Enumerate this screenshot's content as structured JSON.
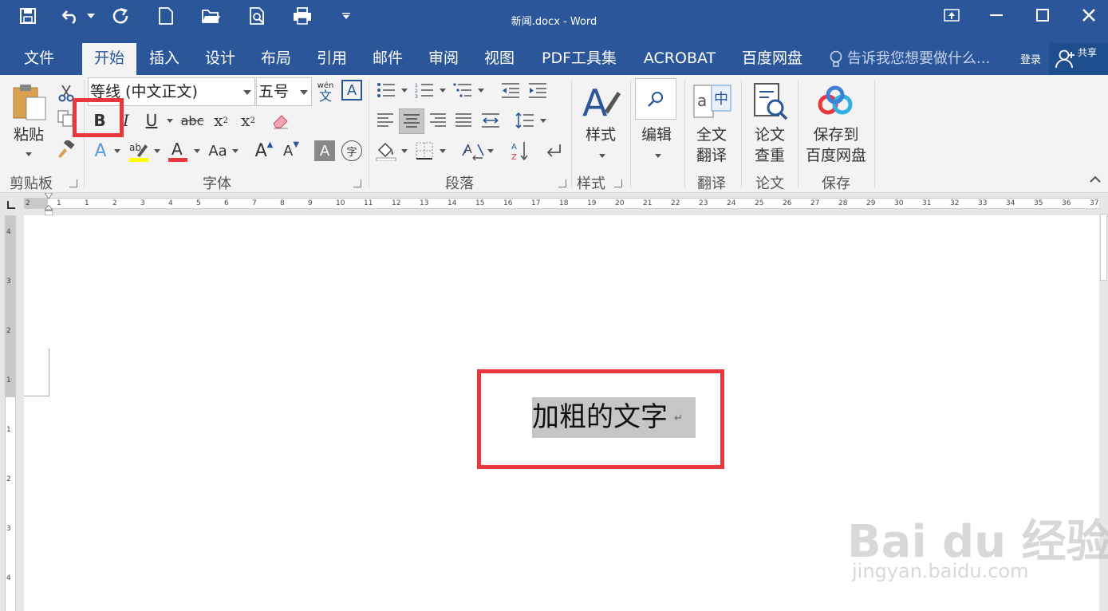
{
  "window": {
    "title": "新闻.docx - Word"
  },
  "tabs": [
    "文件",
    "开始",
    "插入",
    "设计",
    "布局",
    "引用",
    "邮件",
    "审阅",
    "视图",
    "PDF工具集",
    "ACROBAT",
    "百度网盘"
  ],
  "active_tab": "开始",
  "tell_me": {
    "placeholder": "告诉我您想要做什么..."
  },
  "account": {
    "login": "登录",
    "share": "共享"
  },
  "ribbon": {
    "clipboard": {
      "label": "剪贴板",
      "paste": "粘贴"
    },
    "font": {
      "label": "字体",
      "name": "等线 (中文正文)",
      "size": "五号",
      "phonetic_top": "wén",
      "phonetic_bottom": "文",
      "bold": "B",
      "italic": "I",
      "underline": "U",
      "strike": "abc",
      "sub": "x",
      "sub_mark": "2",
      "sup": "x",
      "sup_mark": "2",
      "grow": "A",
      "shrink": "A",
      "change_case": "Aa",
      "shade": "A",
      "enclose": "字",
      "border_char": "A"
    },
    "paragraph": {
      "label": "段落"
    },
    "styles": {
      "label": "样式",
      "button": "样式"
    },
    "editing": {
      "button": "编辑"
    },
    "translate": {
      "label": "翻译",
      "button_line1": "全文",
      "button_line2": "翻译"
    },
    "paper": {
      "label": "论文",
      "button_line1": "论文",
      "button_line2": "查重"
    },
    "save": {
      "label": "保存",
      "button_line1": "保存到",
      "button_line2": "百度网盘"
    }
  },
  "ruler": {
    "h_numbers": [
      "2",
      "1",
      "1",
      "2",
      "3",
      "4",
      "5",
      "6",
      "7",
      "8",
      "9",
      "10",
      "11",
      "12",
      "13",
      "14",
      "15",
      "16",
      "17",
      "18",
      "19",
      "20",
      "21",
      "22",
      "23",
      "24",
      "25",
      "26",
      "27",
      "28",
      "29",
      "30",
      "31",
      "32",
      "33",
      "34",
      "35",
      "36",
      "37"
    ],
    "v_numbers": [
      "4",
      "3",
      "2",
      "1",
      "1",
      "2",
      "3",
      "4"
    ]
  },
  "document": {
    "selected_text": "加粗的文字",
    "para_mark": "↵"
  },
  "watermark": {
    "brand": "Bai du 经验",
    "url": "jingyan.baidu.com"
  },
  "colors": {
    "titlebar": "#2b579a",
    "highlight": "#e8383d",
    "selection": "#c6c6c6"
  }
}
